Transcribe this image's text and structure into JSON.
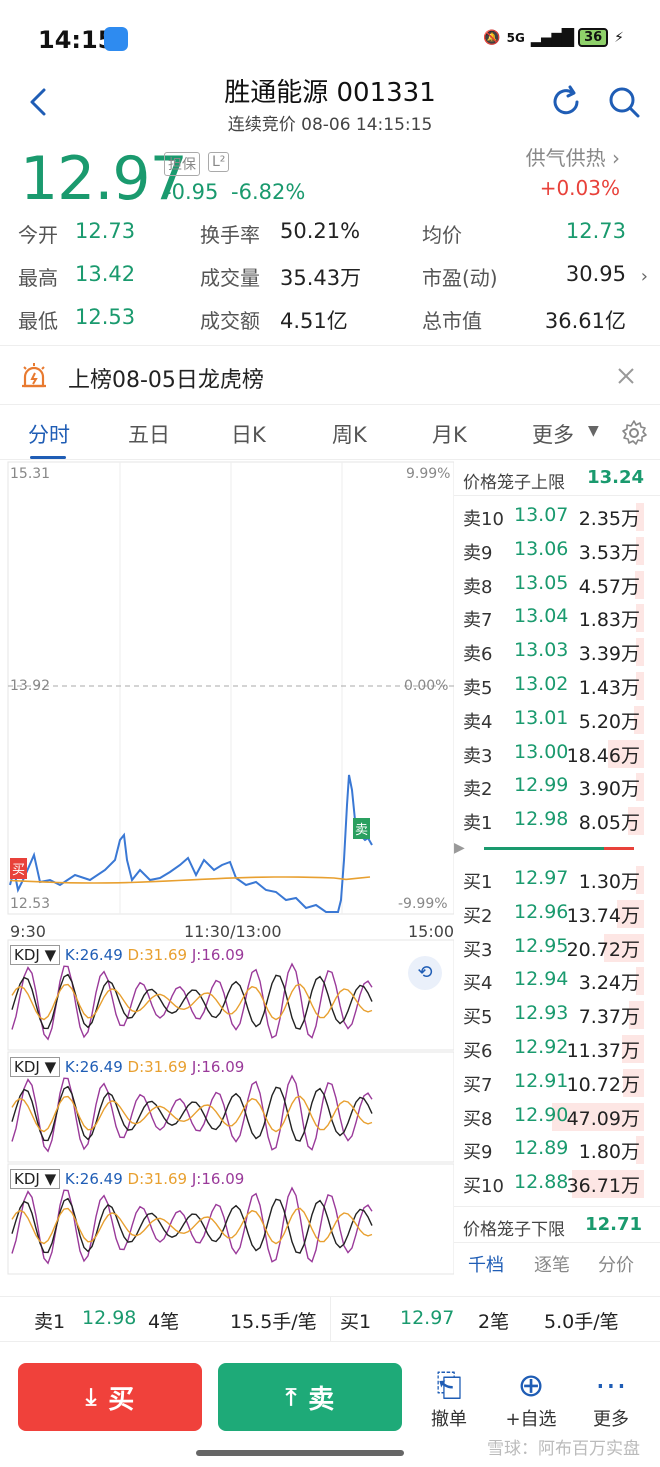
{
  "status": {
    "time": "14:15",
    "net": "5G",
    "battery": "36"
  },
  "header": {
    "title": "胜通能源 001331",
    "subtitle": "连续竞价 08-06 14:15:15"
  },
  "quote": {
    "price": "12.97",
    "tag1": "担保",
    "tag2": "L²",
    "change": "-0.95",
    "change_pct": "-6.82%",
    "sector_name": "供气供热 ›",
    "sector_change": "+0.03%",
    "stats": [
      {
        "label": "今开",
        "value": "12.73"
      },
      {
        "label": "换手率",
        "value": "50.21%"
      },
      {
        "label": "均价",
        "value": "12.73"
      },
      {
        "label": "最高",
        "value": "13.42"
      },
      {
        "label": "成交量",
        "value": "35.43万"
      },
      {
        "label": "市盈(动)",
        "value": "30.95"
      },
      {
        "label": "最低",
        "value": "12.53"
      },
      {
        "label": "成交额",
        "value": "4.51亿"
      },
      {
        "label": "总市值",
        "value": "36.61亿"
      }
    ]
  },
  "banner": {
    "text": "上榜08-05日龙虎榜"
  },
  "tabs": [
    "分时",
    "五日",
    "日K",
    "周K",
    "月K",
    "更多"
  ],
  "chart_labels": {
    "top_price": "15.31",
    "top_pct": "9.99%",
    "mid_price": "13.92",
    "mid_pct": "0.00%",
    "bot_price": "12.53",
    "bot_pct": "-9.99%",
    "time_start": "9:30",
    "time_mid": "11:30/13:00",
    "time_end": "15:00",
    "buy_marker": "买",
    "sell_marker": "卖"
  },
  "kdj": [
    {
      "name": "KDJ ▼",
      "k": "K:26.49",
      "d": "D:31.69",
      "j": "J:16.09"
    },
    {
      "name": "KDJ ▼",
      "k": "K:26.49",
      "d": "D:31.69",
      "j": "J:16.09"
    },
    {
      "name": "KDJ ▼",
      "k": "K:26.49",
      "d": "D:31.69",
      "j": "J:16.09"
    }
  ],
  "book": {
    "upper_label": "价格笼子上限",
    "upper_value": "13.24",
    "lower_label": "价格笼子下限",
    "lower_value": "12.71",
    "asks": [
      {
        "label": "卖10",
        "price": "13.07",
        "vol": "2.35万",
        "bar": 0.05
      },
      {
        "label": "卖9",
        "price": "13.06",
        "vol": "3.53万",
        "bar": 0.08
      },
      {
        "label": "卖8",
        "price": "13.05",
        "vol": "4.57万",
        "bar": 0.1
      },
      {
        "label": "卖7",
        "price": "13.04",
        "vol": "1.83万",
        "bar": 0.04
      },
      {
        "label": "卖6",
        "price": "13.03",
        "vol": "3.39万",
        "bar": 0.07
      },
      {
        "label": "卖5",
        "price": "13.02",
        "vol": "1.43万",
        "bar": 0.03
      },
      {
        "label": "卖4",
        "price": "13.01",
        "vol": "5.20万",
        "bar": 0.11
      },
      {
        "label": "卖3",
        "price": "13.00",
        "vol": "18.46万",
        "bar": 0.39
      },
      {
        "label": "卖2",
        "price": "12.99",
        "vol": "3.90万",
        "bar": 0.08
      },
      {
        "label": "卖1",
        "price": "12.98",
        "vol": "8.05万",
        "bar": 0.17
      }
    ],
    "bids": [
      {
        "label": "买1",
        "price": "12.97",
        "vol": "1.30万",
        "bar": 0.03
      },
      {
        "label": "买2",
        "price": "12.96",
        "vol": "13.74万",
        "bar": 0.29
      },
      {
        "label": "买3",
        "price": "12.95",
        "vol": "20.72万",
        "bar": 0.44
      },
      {
        "label": "买4",
        "price": "12.94",
        "vol": "3.24万",
        "bar": 0.07
      },
      {
        "label": "买5",
        "price": "12.93",
        "vol": "7.37万",
        "bar": 0.16
      },
      {
        "label": "买6",
        "price": "12.92",
        "vol": "11.37万",
        "bar": 0.24
      },
      {
        "label": "买7",
        "price": "12.91",
        "vol": "10.72万",
        "bar": 0.23
      },
      {
        "label": "买8",
        "price": "12.90",
        "vol": "47.09万",
        "bar": 1.0
      },
      {
        "label": "买9",
        "price": "12.89",
        "vol": "1.80万",
        "bar": 0.04
      },
      {
        "label": "买10",
        "price": "12.88",
        "vol": "36.71万",
        "bar": 0.78
      }
    ],
    "footer_tabs": [
      "千档",
      "逐笔",
      "分价"
    ]
  },
  "ticks": {
    "ask_label": "卖1",
    "ask_price": "12.98",
    "ask_count": "4笔",
    "ask_avg": "15.5手/笔",
    "bid_label": "买1",
    "bid_price": "12.97",
    "bid_count": "2笔",
    "bid_avg": "5.0手/笔"
  },
  "actions": {
    "buy": "买",
    "sell": "卖",
    "cancel": "撤单",
    "watch": "+自选",
    "more": "更多"
  },
  "watermark": "雪球：阿布百万实盘",
  "colors": {
    "up": "#e8413a",
    "down": "#1a9a6e",
    "accent": "#1f5db5",
    "price_line": "#3a78d4",
    "avg_line": "#e8a030"
  }
}
